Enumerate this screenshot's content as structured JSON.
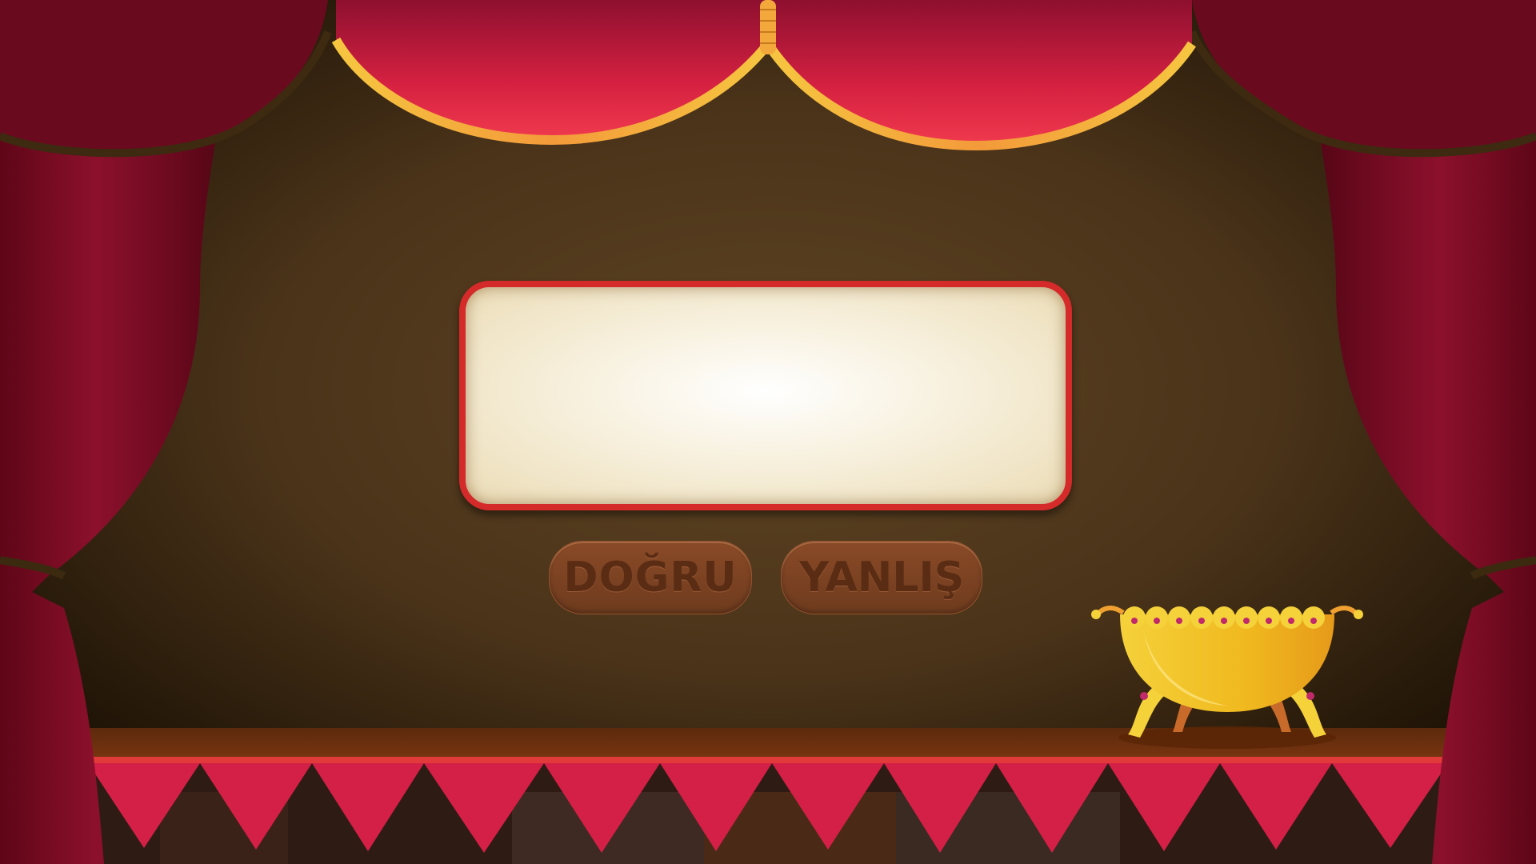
{
  "game": {
    "question": "",
    "answers": {
      "true_label": "DOĞRU",
      "false_label": "YANLIŞ"
    }
  },
  "colors": {
    "curtain": "#8a0f2a",
    "valance": "#d8243f",
    "valance_trim": "#f3b13a",
    "backdrop": "#5a3f22",
    "panel_border": "#d42a2a",
    "button": "#7a4122",
    "button_text": "#5a2c14",
    "cauldron": "#f0c020"
  },
  "icons": {
    "prop": "golden-bowl-icon"
  }
}
